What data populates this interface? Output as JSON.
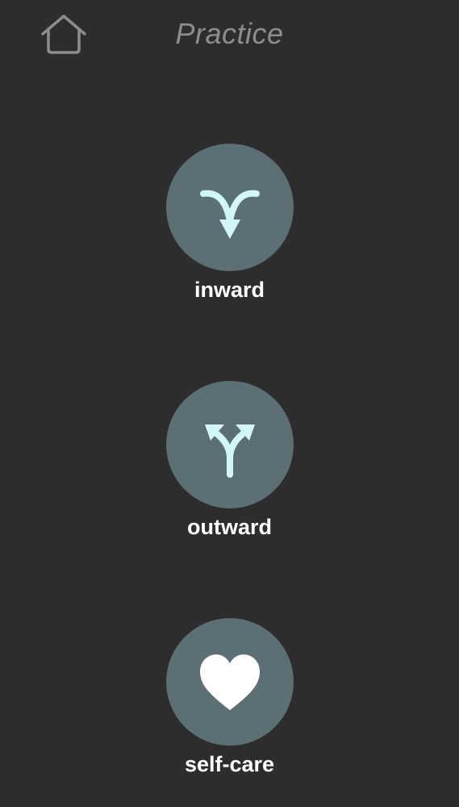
{
  "header": {
    "title": "Practice",
    "home_icon": "home-icon"
  },
  "options": [
    {
      "label": "inward",
      "icon": "merge-arrows-in-icon"
    },
    {
      "label": "outward",
      "icon": "split-arrows-out-icon"
    },
    {
      "label": "self-care",
      "icon": "heart-icon"
    }
  ],
  "colors": {
    "background": "#2e2d2e",
    "circle": "#5c6f75",
    "icon_accent": "#d2f7fa",
    "title": "#8e8d8e",
    "label": "#ffffff"
  }
}
